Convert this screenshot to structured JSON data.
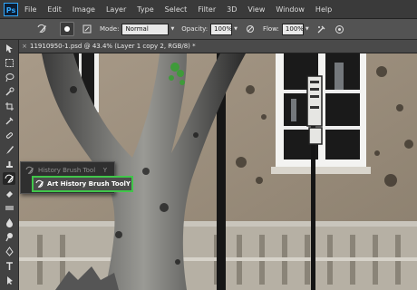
{
  "app": {
    "logo": "Ps"
  },
  "menu": [
    "File",
    "Edit",
    "Image",
    "Layer",
    "Type",
    "Select",
    "Filter",
    "3D",
    "View",
    "Window",
    "Help"
  ],
  "options": {
    "mode_label": "Mode:",
    "mode_value": "Normal",
    "opacity_label": "Opacity:",
    "opacity_value": "100%",
    "flow_label": "Flow:",
    "flow_value": "100%"
  },
  "document": {
    "tab_title": "11910950-1.psd @ 43.4% (Layer 1 copy 2, RGB/8) *",
    "close_glyph": "×"
  },
  "flyout": {
    "items": [
      {
        "label": "History Brush Tool",
        "shortcut": "Y"
      },
      {
        "label": "Art History Brush Tool",
        "shortcut": "Y"
      }
    ],
    "highlight_color": "#41c64a"
  },
  "colors": {
    "ps_blue": "#31a8ff",
    "highlight_green": "#41c64a"
  },
  "icons": {
    "toolbar": [
      "move-icon",
      "marquee-icon",
      "lasso-icon",
      "quick-select-icon",
      "crop-icon",
      "eyedropper-icon",
      "spot-healing-icon",
      "brush-icon",
      "clone-stamp-icon",
      "history-brush-icon",
      "eraser-icon",
      "gradient-icon",
      "blur-icon",
      "dodge-icon",
      "pen-icon",
      "type-icon",
      "path-select-icon",
      "shape-icon",
      "hand-icon",
      "zoom-icon"
    ]
  }
}
